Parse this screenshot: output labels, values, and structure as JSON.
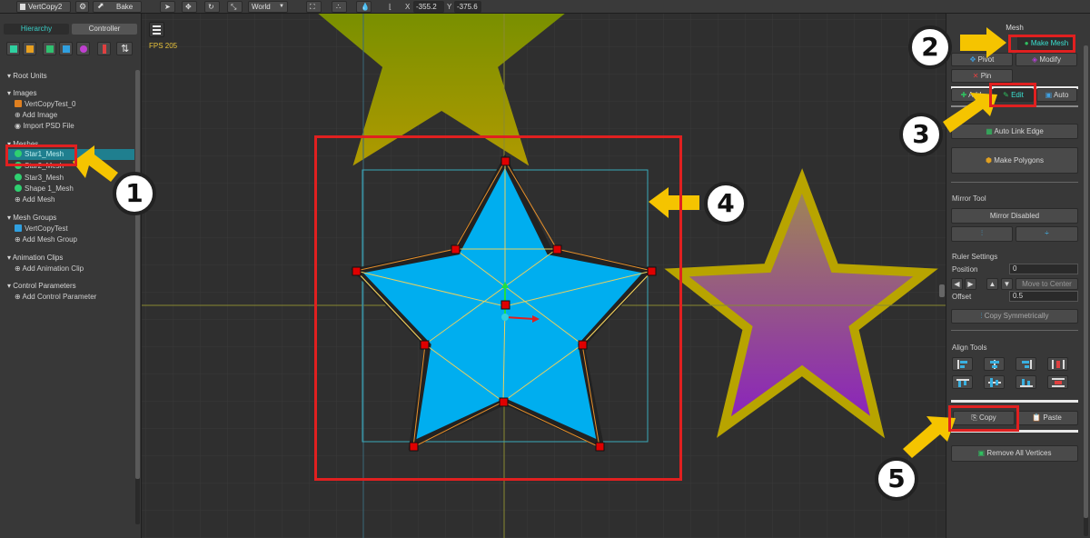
{
  "toolbar": {
    "file_name": "VertCopy2",
    "bake_label": "Bake",
    "space_label": "World",
    "x_label": "X",
    "x_value": "-355.2",
    "y_label": "Y",
    "y_value": "-375.6"
  },
  "left_panel": {
    "tabs": [
      "Hierarchy",
      "Controller"
    ],
    "sections": {
      "root_units": "Root Units",
      "images": "Images",
      "meshes": "Meshes",
      "mesh_groups": "Mesh Groups",
      "animation_clips": "Animation Clips",
      "control_parameters": "Control Parameters"
    },
    "images": [
      "VertCopyTest_0",
      "Add Image",
      "Import PSD File"
    ],
    "meshes": [
      "Star1_Mesh",
      "Star2_Mesh",
      "Star3_Mesh",
      "Shape 1_Mesh",
      "Add Mesh"
    ],
    "mesh_groups": [
      "VertCopyTest",
      "Add Mesh Group"
    ],
    "animation_clips": [
      "Add Animation Clip"
    ],
    "control_parameters": [
      "Add Control Parameter"
    ]
  },
  "canvas": {
    "fps": "FPS 205"
  },
  "right_panel": {
    "title": "Mesh",
    "make_mesh": "Make Mesh",
    "pivot": "Pivot",
    "modify": "Modify",
    "pin": "Pin",
    "add": "Add",
    "edit": "Edit",
    "auto": "Auto",
    "auto_link_edge": "Auto Link Edge",
    "make_polygons": "Make Polygons",
    "mirror_tool": "Mirror Tool",
    "mirror_disabled": "Mirror Disabled",
    "ruler_settings": "Ruler Settings",
    "position_label": "Position",
    "position_value": "0",
    "move_to_center": "Move to Center",
    "offset_label": "Offset",
    "offset_value": "0.5",
    "copy_symmetrically": "Copy Symmetrically",
    "align_tools": "Align Tools",
    "copy": "Copy",
    "paste": "Paste",
    "remove_all_vertices": "Remove All Vertices"
  },
  "annotations": [
    "1",
    "2",
    "3",
    "4",
    "5"
  ],
  "colors": {
    "accent_selection": "#1f7f8f",
    "annotation_red": "#e02020",
    "arrow_yellow": "#f5c400",
    "star_blue": "#00aeef"
  }
}
